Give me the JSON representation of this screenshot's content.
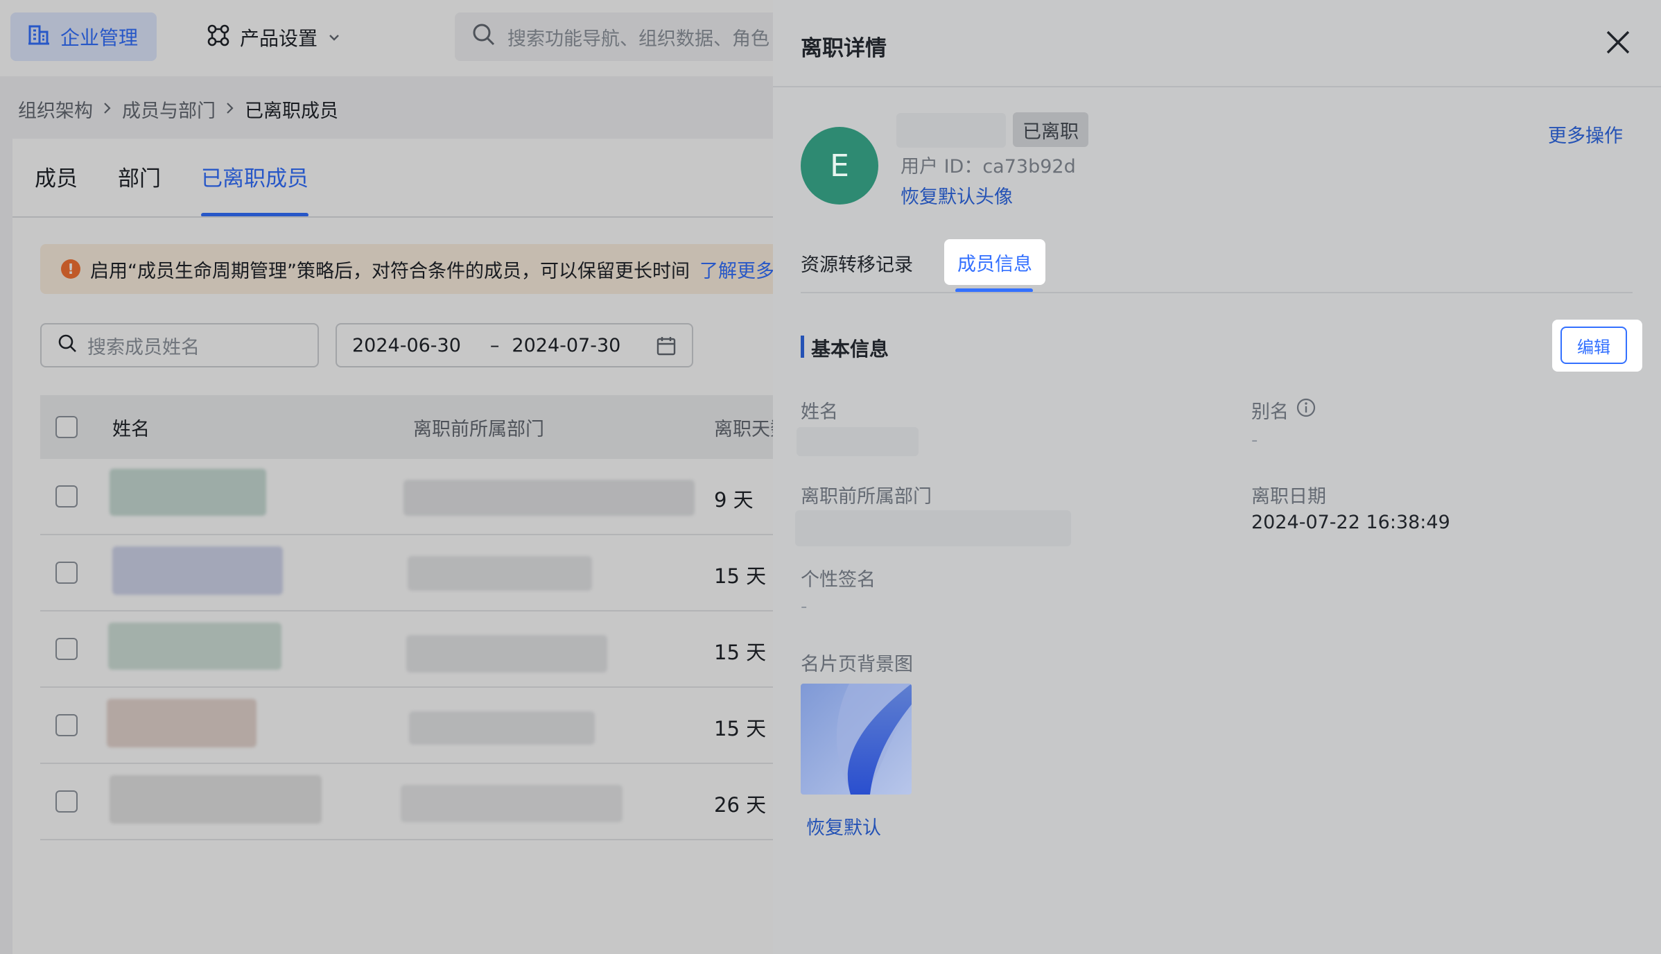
{
  "topbar": {
    "enterprise_label": "企业管理",
    "product_label": "产品设置",
    "search_placeholder": "搜索功能导航、组织数据、角色"
  },
  "breadcrumb": [
    "组织架构",
    "成员与部门",
    "已离职成员"
  ],
  "tabs": [
    {
      "label": "成员",
      "active": false
    },
    {
      "label": "部门",
      "active": false
    },
    {
      "label": "已离职成员",
      "active": true
    }
  ],
  "notice": {
    "text": "启用“成员生命周期管理”策略后，对符合条件的成员，可以保留更长时间",
    "link": "了解更多"
  },
  "filters": {
    "search_placeholder": "搜索成员姓名",
    "date_start": "2024-06-30",
    "date_sep": "–",
    "date_end": "2024-07-30"
  },
  "table": {
    "headers": [
      "姓名",
      "离职前所属部门",
      "离职天数"
    ],
    "rows": [
      {
        "days": "9 天"
      },
      {
        "days": "15 天"
      },
      {
        "days": "15 天"
      },
      {
        "days": "15 天"
      },
      {
        "days": "26 天"
      }
    ]
  },
  "panel": {
    "title": "离职详情",
    "avatar_letter": "E",
    "status_badge": "已离职",
    "user_id": "用户 ID：ca73b92d",
    "reset_avatar": "恢复默认头像",
    "more_actions": "更多操作",
    "tabs": [
      {
        "label": "资源转移记录",
        "active": false
      },
      {
        "label": "成员信息",
        "active": true
      }
    ],
    "section_title": "基本信息",
    "edit_label": "编辑",
    "fields": {
      "name_label": "姓名",
      "alias_label": "别名",
      "alias_value": "-",
      "dept_label": "离职前所属部门",
      "date_label": "离职日期",
      "date_value": "2024-07-22 16:38:49",
      "signature_label": "个性签名",
      "signature_value": "-",
      "bg_label": "名片页背景图"
    },
    "reset_bg": "恢复默认"
  },
  "colors": {
    "accent": "#3370ff",
    "avatar_bg": "#2e8a72",
    "warn": "#f77234"
  }
}
